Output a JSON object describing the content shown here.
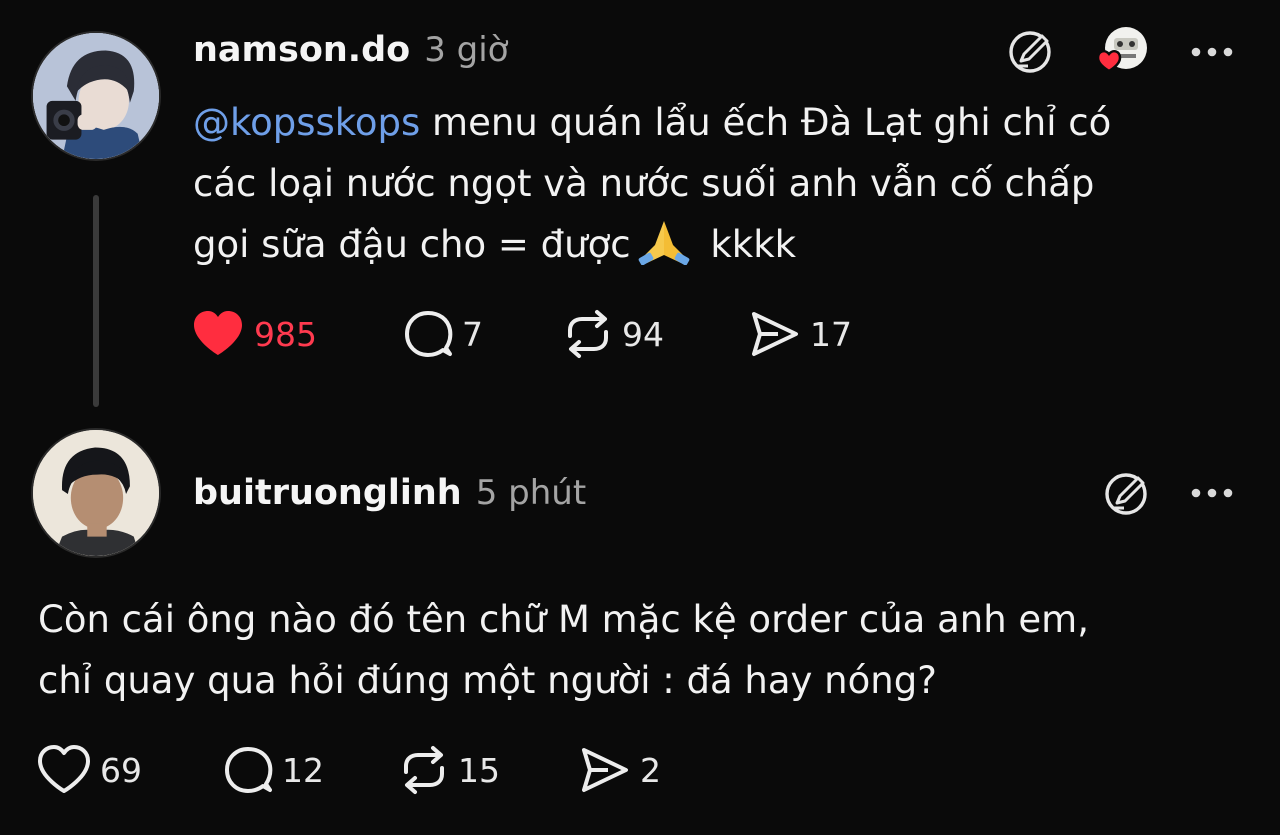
{
  "posts": [
    {
      "username": "namson.do",
      "time": "3 giờ",
      "mention": "@kopsskops",
      "text_line1": " menu quán lẩu ếch Đà Lạt ghi chỉ có",
      "text_line2": "các loại nước ngọt và nước suối anh vẫn cố chấp",
      "text_line3a": "gọi sữa đậu cho = được",
      "text_line3b": "kkkk",
      "emoji": "folded-hands",
      "liked": true,
      "likes": "985",
      "replies": "7",
      "reposts": "94",
      "shares": "17"
    },
    {
      "username": "buitruonglinh",
      "time": "5 phút",
      "text_line1": "Còn cái ông nào đó tên chữ M mặc kệ order của anh em,",
      "text_line2": "chỉ quay qua hỏi đúng một người : đá hay nóng?",
      "liked": false,
      "likes": "69",
      "replies": "12",
      "reposts": "15",
      "shares": "2"
    }
  ],
  "colors": {
    "background": "#0a0a0a",
    "mention": "#6f9fe8",
    "like_active": "#ff3a4f",
    "muted": "#a4a4a4"
  },
  "icons": [
    "heart-icon",
    "reply-icon",
    "repost-icon",
    "share-icon",
    "edit-icon",
    "more-icon"
  ]
}
